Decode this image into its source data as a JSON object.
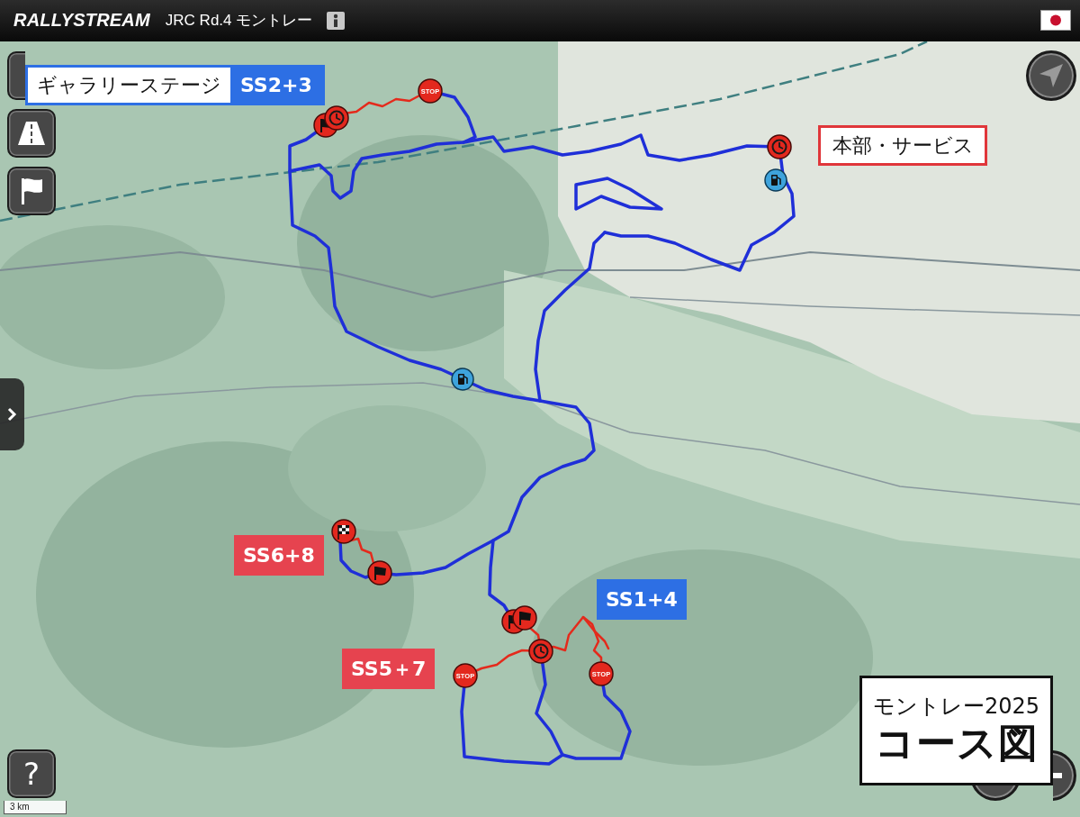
{
  "header": {
    "logo": "RALLYSTREAM",
    "title": "JRC Rd.4 モントレー"
  },
  "callouts": [
    {
      "kind": "gallery",
      "title": "ギャラリーステージ",
      "stage": "SS2+3",
      "color": "#2d6fe4"
    },
    {
      "kind": "boxed",
      "text": "本部・サービス",
      "color": "#e0363a"
    },
    {
      "kind": "stage",
      "text": "SS6+8",
      "color": "#e6434f"
    },
    {
      "kind": "stage",
      "text": "SS1+4",
      "color": "#2d6fe4"
    },
    {
      "kind": "stage",
      "text": "SS5＋7",
      "color": "#e6434f"
    }
  ],
  "markers": [
    {
      "kind": "start"
    },
    {
      "kind": "time-control"
    },
    {
      "kind": "stop",
      "label": "STOP"
    },
    {
      "kind": "time-control"
    },
    {
      "kind": "fuel"
    },
    {
      "kind": "fuel"
    },
    {
      "kind": "finish"
    },
    {
      "kind": "start"
    },
    {
      "kind": "start"
    },
    {
      "kind": "start"
    },
    {
      "kind": "time-control"
    },
    {
      "kind": "stop",
      "label": "STOP"
    },
    {
      "kind": "stop",
      "label": "STOP"
    }
  ],
  "help_button": {
    "label": "?"
  },
  "scale_bar": {
    "label": "3 km"
  },
  "title_card": {
    "subtitle": "モントレー2025",
    "title": "コース図"
  }
}
